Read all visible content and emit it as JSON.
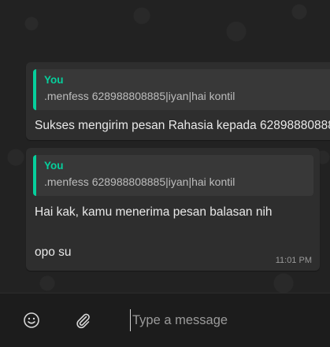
{
  "messages": [
    {
      "quote_author": "You",
      "quote_text": ".menfess 628988808885|iyan|hai kontil",
      "text": "Sukses mengirim pesan Rahasia kepada 62898880888"
    },
    {
      "quote_author": "You",
      "quote_text": ".menfess 628988808885|iyan|hai kontil",
      "text_line_1": "Hai kak, kamu menerima pesan balasan nih",
      "text_line_2": "opo su",
      "time": "11:01 PM"
    }
  ],
  "composer": {
    "placeholder": "Type a message",
    "emoji_icon": "emoji-smile-icon",
    "attach_icon": "paperclip-icon"
  },
  "colors": {
    "accent": "#06cf9c",
    "bubble": "#2e2e2e",
    "background": "#222222"
  }
}
